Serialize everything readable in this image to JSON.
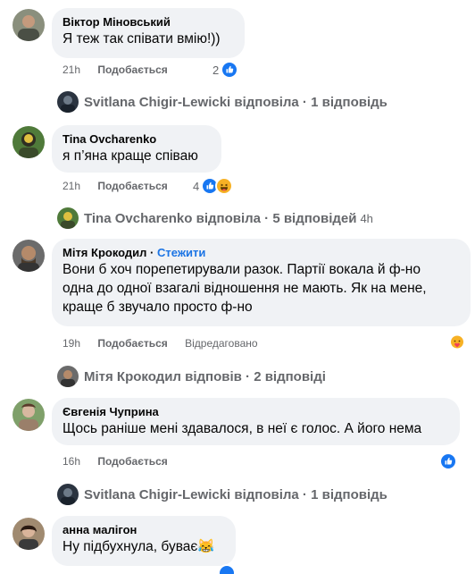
{
  "comments": [
    {
      "author": "Віктор Міновський",
      "text": "Я теж так співати вмію!))",
      "time": "21h",
      "like_label": "Подобається",
      "reaction_count": "2",
      "reactions": [
        "like-icon"
      ]
    },
    {
      "author": "Tina Ovcharenko",
      "text": "я п’яна краще співаю",
      "time": "21h",
      "like_label": "Подобається",
      "reaction_count": "4",
      "reactions": [
        "like-icon",
        "haha-icon"
      ]
    },
    {
      "author": "Мітя Крокодил",
      "follow_label": "Стежити",
      "text_lines": [
        "Вони б хоч порепетирували разок. Партії вокала й ф-но",
        "одна до одної взагалі відношення не мають. Як на мене,",
        "краще б звучало просто ф-но"
      ],
      "time": "19h",
      "like_label": "Подобається",
      "edited_label": "Відредаговано",
      "reactions": [
        "care-icon"
      ]
    },
    {
      "author": "Євгенія Чуприна",
      "text": "Щось раніше мені здавалося, в неї є голос. А його нема",
      "time": "16h",
      "like_label": "Подобається",
      "reactions": [
        "like-icon"
      ]
    },
    {
      "author": "анна малігон",
      "text": "Ну підбухнула, буває",
      "emoji": "😹"
    }
  ],
  "replies": [
    {
      "text": "Svitlana Chigir-Lewicki відповіла · 1 відповідь"
    },
    {
      "text": "Tina Ovcharenko відповіла · 5 відповідей",
      "time": "4h"
    },
    {
      "text": "Мітя Крокодил відповів · 2 відповіді"
    },
    {
      "text": "Svitlana Chigir-Lewicki відповіла · 1 відповідь"
    }
  ],
  "colors": {
    "bubble": "#f0f2f5",
    "meta": "#65676b",
    "like_blue": "#1877f2",
    "follow_blue": "#1b74e4"
  }
}
